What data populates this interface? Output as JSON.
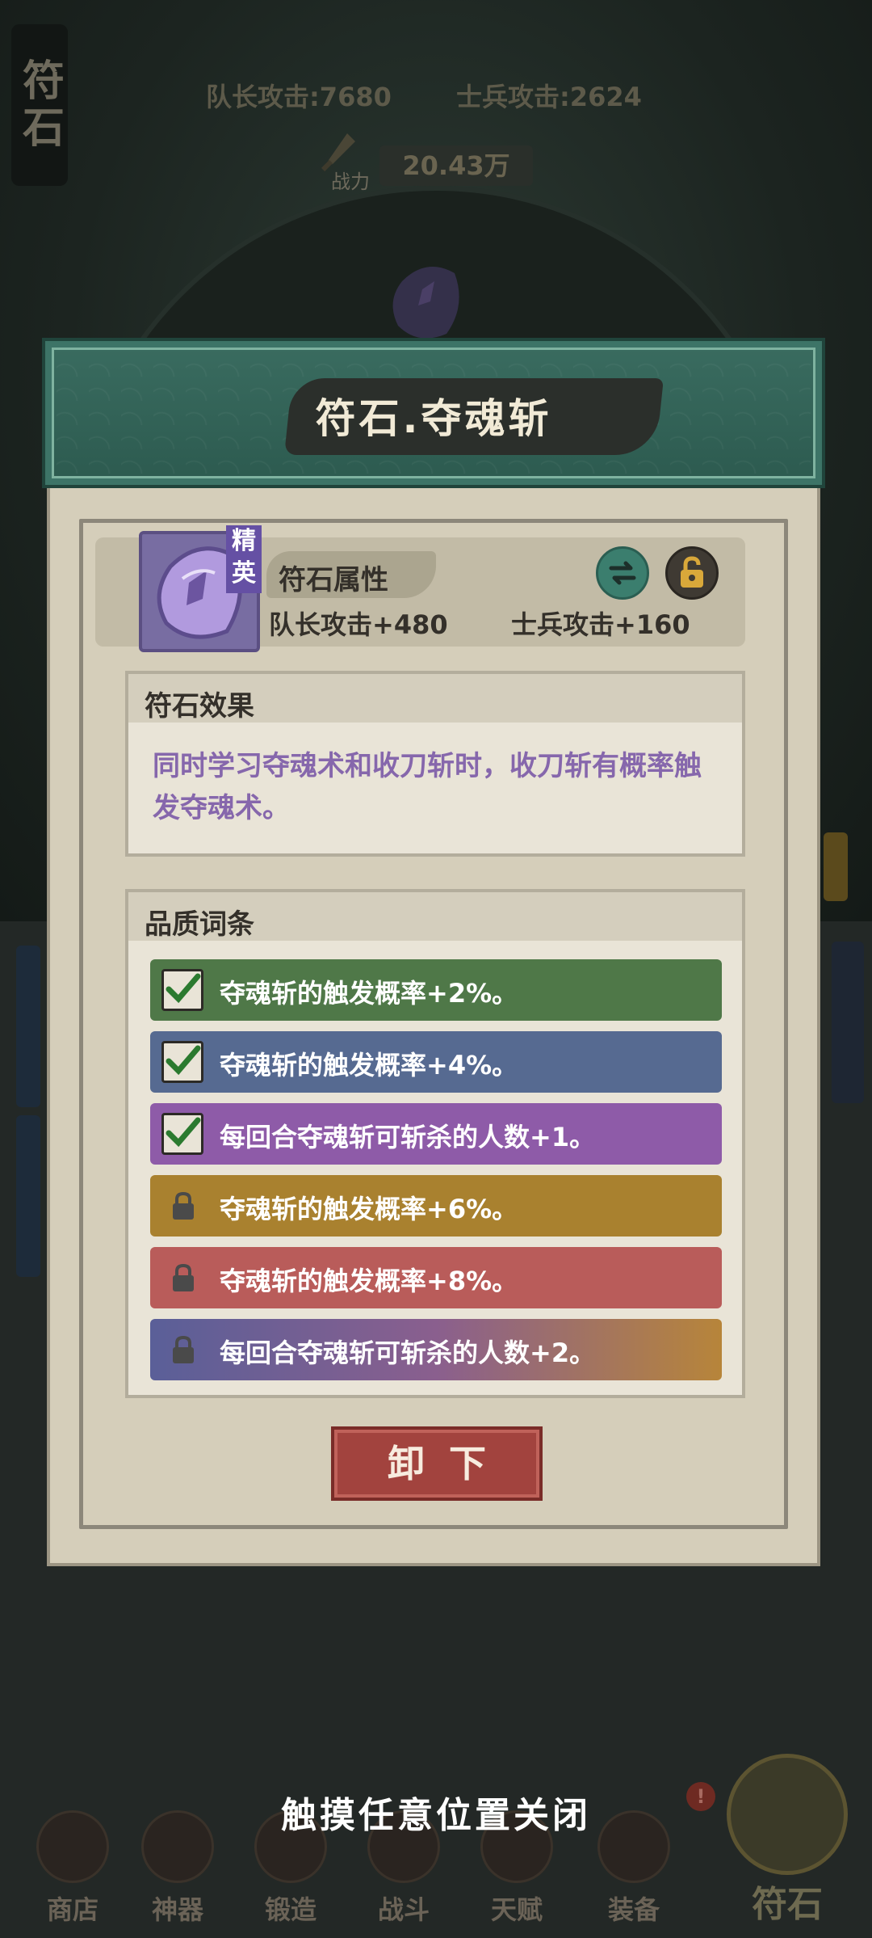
{
  "background": {
    "side_tab": "符石",
    "captain_attack": "队长攻击:7680",
    "soldier_attack": "士兵攻击:2624",
    "power_label": "战力",
    "power_value": "20.43万"
  },
  "modal": {
    "title": "符石.夺魂斩",
    "rune": {
      "rarity_tag": "精英",
      "attr_title": "符石属性",
      "captain_stat": "队长攻击+480",
      "soldier_stat": "士兵攻击+160",
      "swap_icon": "swap-arrows-icon",
      "lock_icon": "lock-icon"
    },
    "effect": {
      "title": "符石效果",
      "text": "同时学习夺魂术和收刀斩时，收刀斩有概率触发夺魂术。"
    },
    "quality": {
      "title": "品质词条",
      "entries": [
        {
          "text": "夺魂斩的触发概率+2%。",
          "unlocked": true,
          "color": "#4f7848"
        },
        {
          "text": "夺魂斩的触发概率+4%。",
          "unlocked": true,
          "color": "#566a91"
        },
        {
          "text": "每回合夺魂斩可斩杀的人数+1。",
          "unlocked": true,
          "color": "#8e5ba8"
        },
        {
          "text": "夺魂斩的触发概率+6%。",
          "unlocked": false,
          "color": "#a9812f"
        },
        {
          "text": "夺魂斩的触发概率+8%。",
          "unlocked": false,
          "color": "#b95c5a"
        },
        {
          "text": "每回合夺魂斩可斩杀的人数+2。",
          "unlocked": false,
          "color": "gradient"
        }
      ]
    },
    "unequip_label": "卸下"
  },
  "dismiss_hint": "触摸任意位置关闭",
  "bottom_nav": {
    "items": [
      "商店",
      "神器",
      "锻造",
      "战斗",
      "天赋",
      "装备"
    ],
    "active": "符石",
    "badge": "!"
  }
}
